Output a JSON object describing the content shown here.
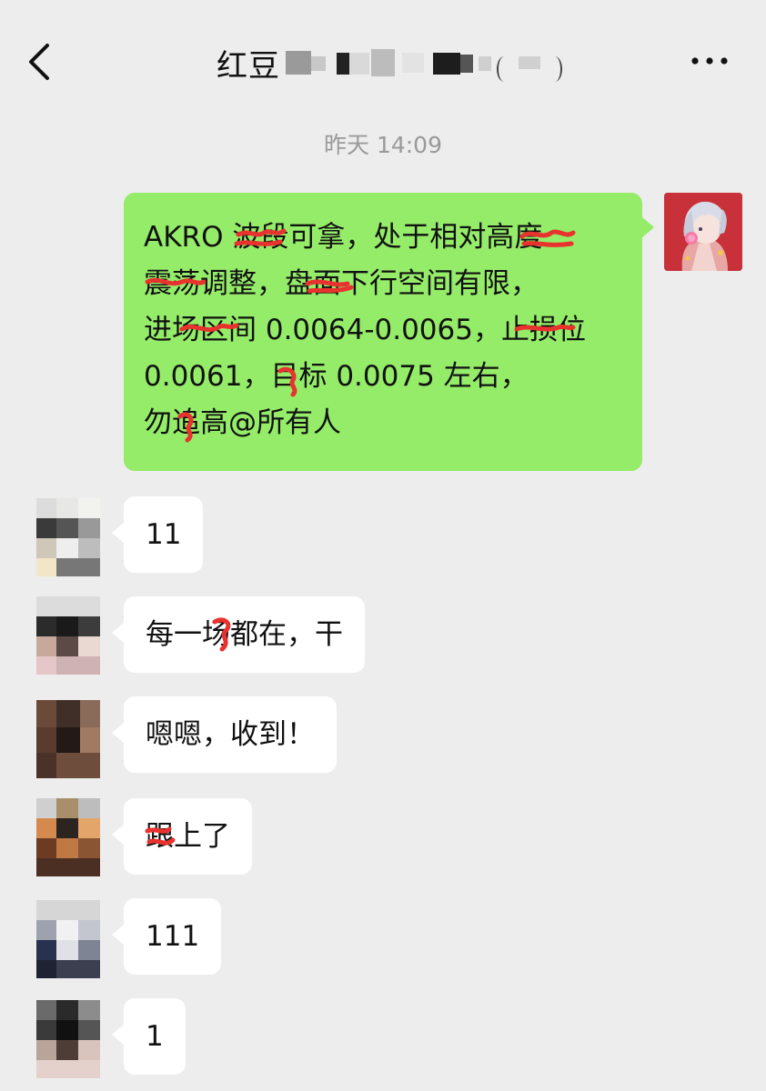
{
  "header": {
    "title_visible": "红豆",
    "back_icon": "chevron-left-icon",
    "more_icon": "ellipsis-icon"
  },
  "timestamp": "昨天 14:09",
  "sent_message": {
    "lines": [
      "AKRO 波段可拿，处于相对高度",
      "震荡调整，盘面下行空间有限，",
      "进场区间 0.0064-0.0065，止损位",
      "0.0061，目标 0.0075 左右，",
      "勿追高@所有人"
    ],
    "bubble_color": "#95ec69"
  },
  "received_messages": [
    {
      "text": "11"
    },
    {
      "text": "每一场都在，干"
    },
    {
      "text": "嗯嗯，收到！"
    },
    {
      "text": "跟上了"
    },
    {
      "text": "111"
    },
    {
      "text": "1"
    }
  ],
  "colors": {
    "background": "#ededed",
    "timestamp": "#9a9a9a",
    "redaction_scribble": "#e8322e"
  }
}
